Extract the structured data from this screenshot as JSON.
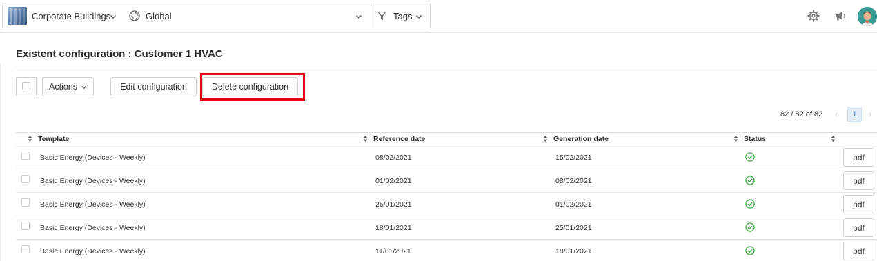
{
  "topbar": {
    "building": "Corporate Buildings",
    "scope": "Global",
    "tags": "Tags"
  },
  "page": {
    "title": "Existent configuration : Customer 1 HVAC"
  },
  "toolbar": {
    "actions_label": "Actions",
    "edit_label": "Edit configuration",
    "delete_label": "Delete configuration"
  },
  "pager": {
    "range": "82 / 82",
    "of": "of",
    "total": "82",
    "current_page": "1"
  },
  "table": {
    "headers": [
      "Template",
      "Reference date",
      "Generation date",
      "Status"
    ],
    "rows": [
      {
        "template": "Basic Energy (Devices - Weekly)",
        "reference_date": "08/02/2021",
        "generation_date": "15/02/2021",
        "action": "pdf"
      },
      {
        "template": "Basic Energy (Devices - Weekly)",
        "reference_date": "01/02/2021",
        "generation_date": "08/02/2021",
        "action": "pdf"
      },
      {
        "template": "Basic Energy (Devices - Weekly)",
        "reference_date": "25/01/2021",
        "generation_date": "01/02/2021",
        "action": "pdf"
      },
      {
        "template": "Basic Energy (Devices - Weekly)",
        "reference_date": "18/01/2021",
        "generation_date": "25/01/2021",
        "action": "pdf"
      },
      {
        "template": "Basic Energy (Devices - Weekly)",
        "reference_date": "11/01/2021",
        "generation_date": "18/01/2021",
        "action": "pdf"
      }
    ]
  },
  "icons": {
    "building": "building-thumbnail-icon",
    "scope": "globe-icon",
    "tags": "filter-icon",
    "settings": "gear-icon",
    "announcements": "megaphone-icon",
    "status_ok": "check-circle-icon",
    "sort": "sort-icon"
  },
  "colors": {
    "highlight": "#e0000d",
    "status_ok": "#3aa83f",
    "pager_active_bg": "#e3eef9",
    "pager_active_text": "#3a7cc0"
  }
}
